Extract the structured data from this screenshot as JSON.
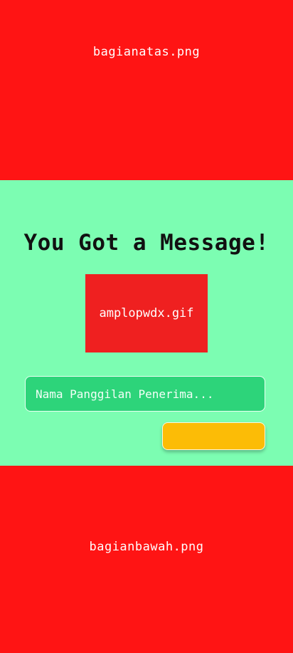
{
  "top_banner": {
    "image_label": "bagianatas.png"
  },
  "message": {
    "title": "You Got a Message!",
    "envelope_image_label": "amplopwdx.gif"
  },
  "form": {
    "name_input": {
      "value": "",
      "placeholder": "Nama Panggilan Penerima..."
    },
    "submit_label": ""
  },
  "bottom_banner": {
    "image_label": "bagianbawah.png"
  },
  "colors": {
    "banner_red": "#ff1414",
    "background_mint": "#7cfdb2",
    "envelope_red": "#ef2020",
    "input_green": "#2dd47a",
    "button_yellow": "#fcbc06"
  }
}
